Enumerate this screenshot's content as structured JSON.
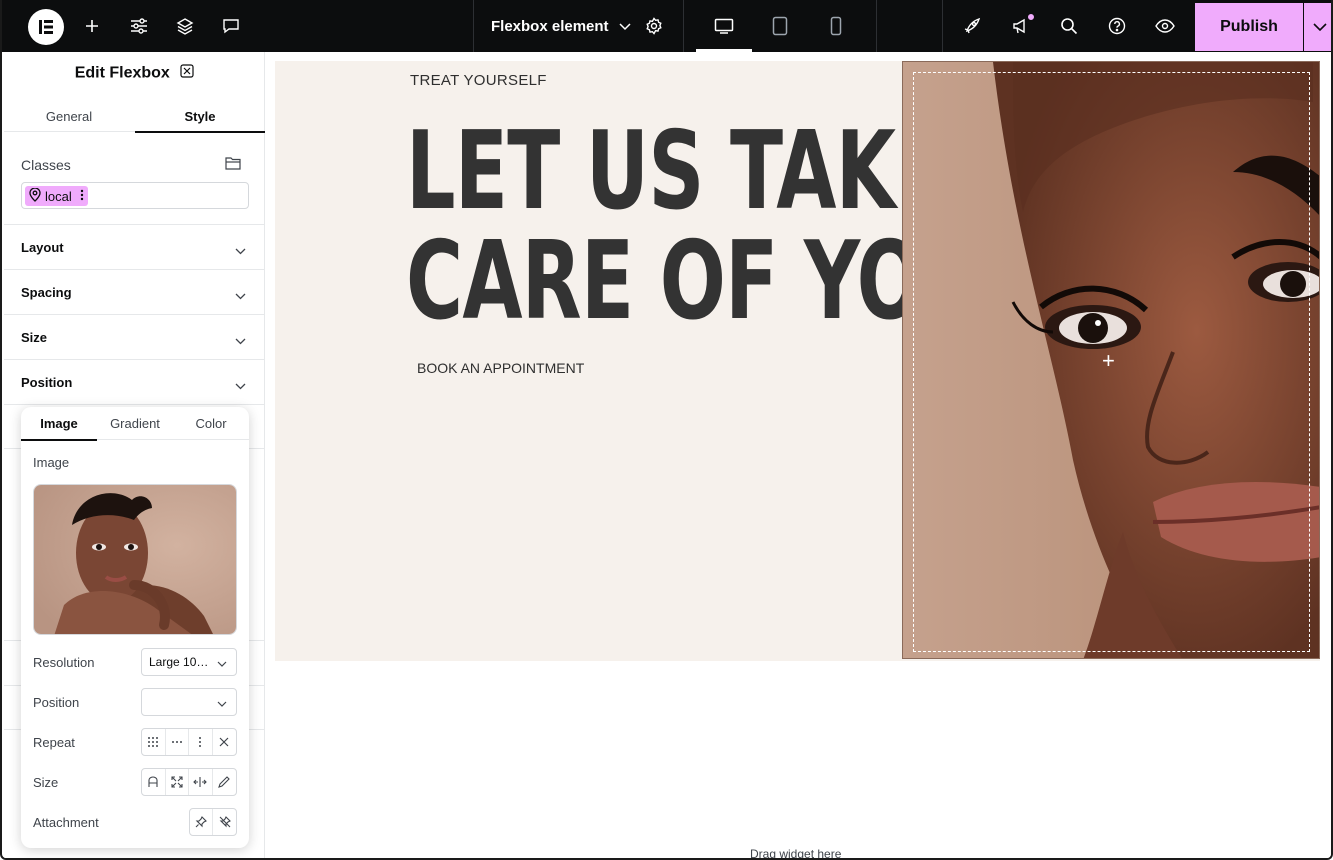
{
  "topbar": {
    "document_title": "Flexbox element",
    "publish_label": "Publish",
    "icons": [
      "elementor-logo-icon",
      "add-icon",
      "site-settings-icon",
      "structure-icon",
      "comments-icon",
      "chevron-down-icon",
      "settings-gear-icon",
      "desktop-icon",
      "tablet-icon",
      "mobile-icon",
      "launchpad-icon",
      "whats-new-icon",
      "search-icon",
      "help-icon",
      "preview-icon",
      "chevron-down-icon"
    ]
  },
  "panel": {
    "title": "Edit Flexbox",
    "tabs": [
      {
        "label": "General"
      },
      {
        "label": "Style"
      }
    ],
    "active_tab": "Style",
    "classes_label": "Classes",
    "class_chip": "local",
    "sections": [
      {
        "label": "Layout"
      },
      {
        "label": "Spacing"
      },
      {
        "label": "Size"
      },
      {
        "label": "Position"
      }
    ]
  },
  "background_popover": {
    "tabs": [
      {
        "label": "Image"
      },
      {
        "label": "Gradient"
      },
      {
        "label": "Color"
      }
    ],
    "active_tab": "Image",
    "image_label": "Image",
    "resolution_label": "Resolution",
    "resolution_value": "Large 10…",
    "position_label": "Position",
    "position_value": "",
    "repeat_label": "Repeat",
    "size_label": "Size",
    "attachment_label": "Attachment"
  },
  "canvas": {
    "eyebrow": "TREAT YOURSELF",
    "headline_line1": "LET US TAKE",
    "headline_line2": "CARE OF YOU",
    "cta": "BOOK AN APPOINTMENT",
    "drop_hint": "Drag widget here"
  },
  "colors": {
    "topbar_bg": "#0c0d0e",
    "accent": "#f0abfc",
    "hero_bg": "#f6f1ec",
    "headline": "#333333",
    "photo_skin": "#b58f7b"
  }
}
